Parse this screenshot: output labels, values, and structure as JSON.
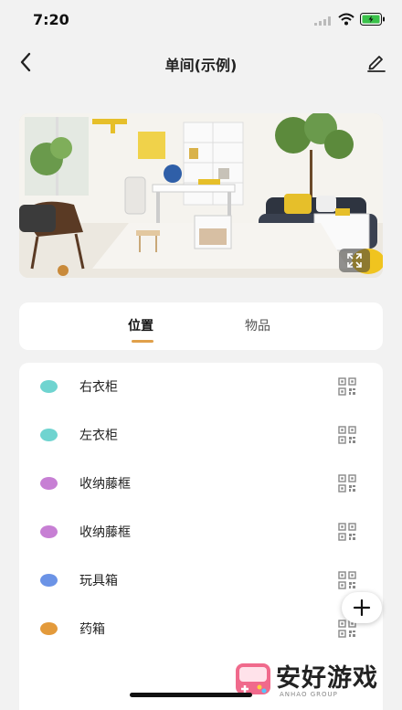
{
  "status": {
    "time": "7:20"
  },
  "header": {
    "title": "单间(示例)"
  },
  "tabs": [
    {
      "label": "位置",
      "active": true
    },
    {
      "label": "物品",
      "active": false
    }
  ],
  "locations": [
    {
      "label": "右衣柜",
      "color": "#6fd4d0"
    },
    {
      "label": "左衣柜",
      "color": "#6fd4d0"
    },
    {
      "label": "收纳藤框",
      "color": "#c77fd4"
    },
    {
      "label": "收纳藤框",
      "color": "#c77fd4"
    },
    {
      "label": "玩具箱",
      "color": "#6b93e6"
    },
    {
      "label": "药箱",
      "color": "#e39a3b"
    }
  ],
  "colors": {
    "tab_indicator": "#e0a04a",
    "background": "#f2f2f2"
  },
  "icons": {
    "back": "chevron-left-icon",
    "edit": "pencil-icon",
    "expand": "expand-icon",
    "qr": "qr-code-icon",
    "add": "plus-icon"
  },
  "watermark": {
    "text": "安好游戏",
    "sub": "ANHAO GROUP"
  }
}
